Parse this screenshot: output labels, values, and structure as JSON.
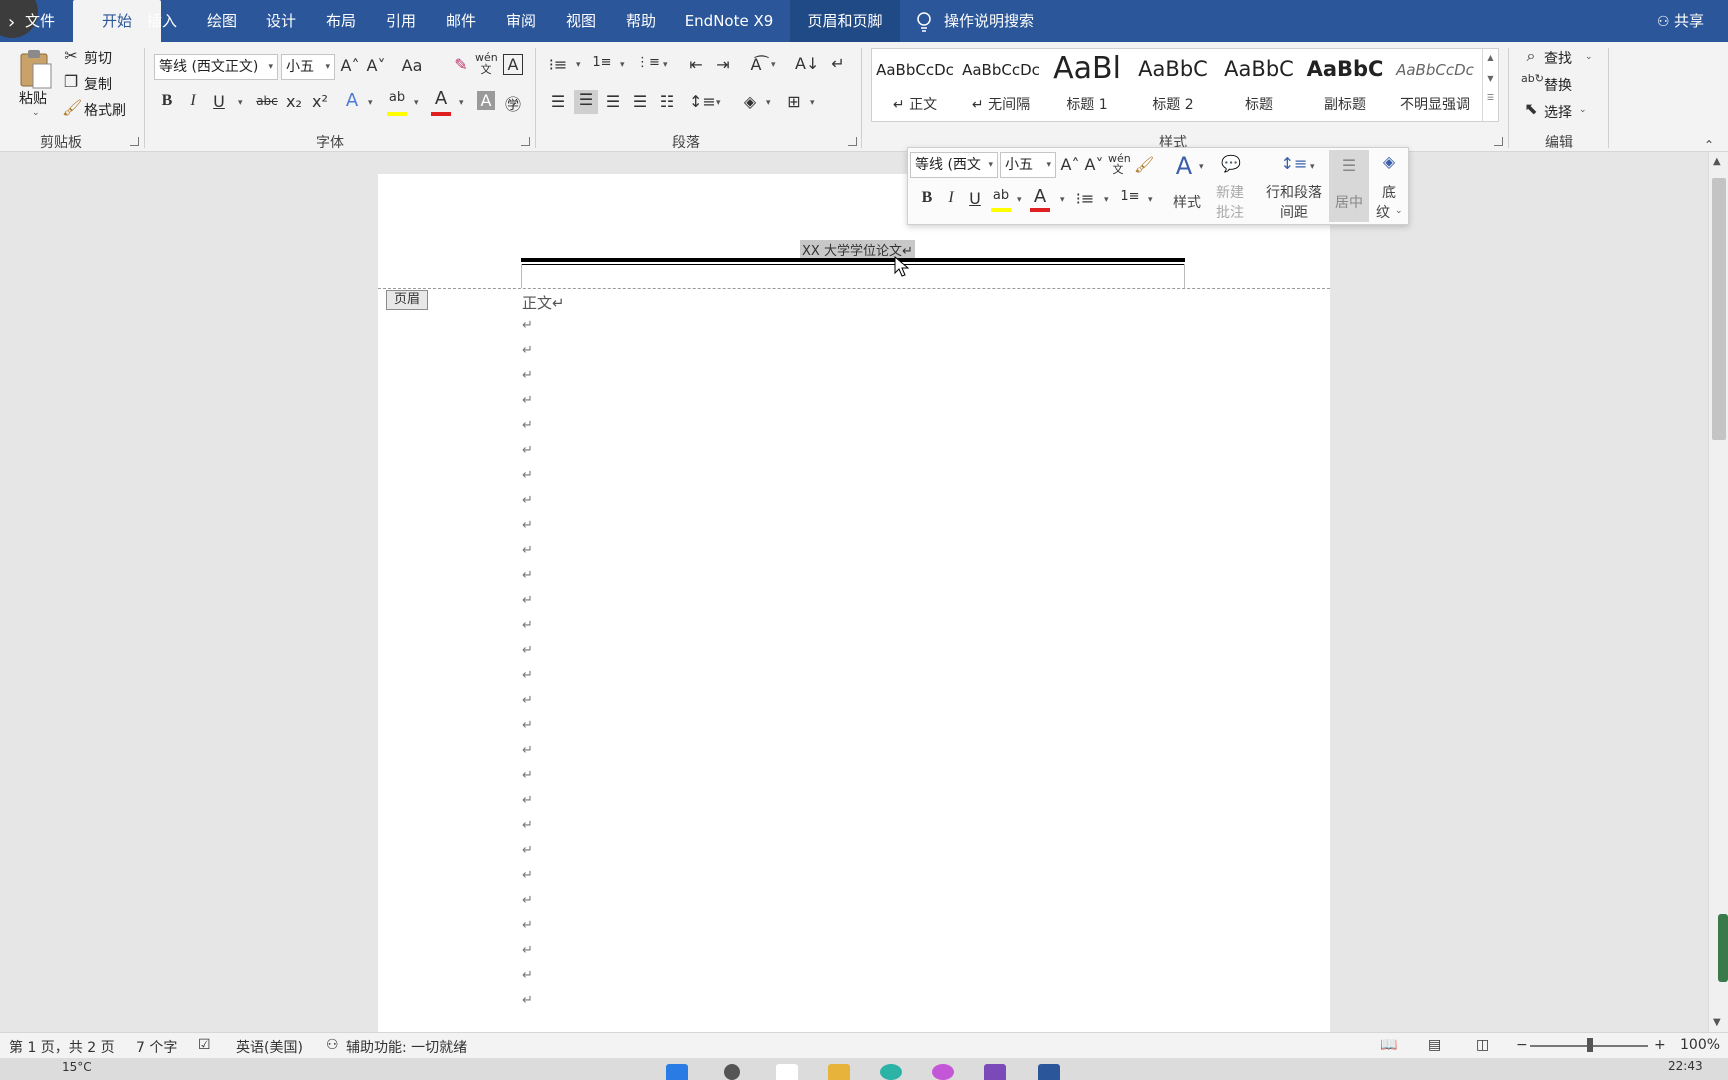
{
  "tabs": {
    "file": "文件",
    "home": "开始",
    "insert": "插入",
    "draw": "绘图",
    "design": "设计",
    "layout": "布局",
    "references": "引用",
    "mailings": "邮件",
    "review": "审阅",
    "view": "视图",
    "help": "帮助",
    "endnote": "EndNote X9",
    "header_footer": "页眉和页脚",
    "tell_me": "操作说明搜索",
    "share": "共享"
  },
  "clipboard": {
    "paste": "粘贴",
    "cut": "剪切",
    "copy": "复制",
    "format_painter": "格式刷",
    "label": "剪贴板"
  },
  "font": {
    "name": "等线 (西文正文)",
    "size": "小五",
    "label": "字体",
    "grow": "A˄",
    "shrink": "A˅",
    "change_case": "Aa",
    "bold": "B",
    "italic": "I",
    "underline": "U",
    "strikethrough": "abc",
    "subscript": "x₂",
    "superscript": "x²",
    "font_color_letter": "A",
    "phonetic": "wén",
    "char_border": "A"
  },
  "paragraph": {
    "label": "段落"
  },
  "styles": {
    "label": "样式",
    "items": [
      {
        "preview": "AaBbCcDc",
        "name": "↵ 正文"
      },
      {
        "preview": "AaBbCcDc",
        "name": "↵ 无间隔"
      },
      {
        "preview": "AaBl",
        "name": "标题 1"
      },
      {
        "preview": "AaBbC",
        "name": "标题 2"
      },
      {
        "preview": "AaBbC",
        "name": "标题"
      },
      {
        "preview": "AaBbC",
        "name": "副标题"
      },
      {
        "preview": "AaBbCcDc",
        "name": "不明显强调"
      }
    ]
  },
  "editing": {
    "find": "查找",
    "replace": "替换",
    "select": "选择",
    "label": "编辑"
  },
  "mini_toolbar": {
    "font": "等线 (西文",
    "size": "小五",
    "styles": "样式",
    "new_comment_1": "新建",
    "new_comment_2": "批注",
    "spacing_1": "行和段落",
    "spacing_2": "间距",
    "center": "居中",
    "shading_1": "底",
    "shading_2": "纹"
  },
  "document": {
    "header_text": "XX 大学学位论文↵",
    "header_tag": "页眉",
    "body_first": "正文↵",
    "para_mark": "↵"
  },
  "status": {
    "page": "第 1 页，共 2 页",
    "words": "7 个字",
    "language": "英语(美国)",
    "accessibility": "辅助功能: 一切就绪",
    "zoom": "100%"
  },
  "taskbar": {
    "temperature": "15°C",
    "time": "22:43"
  },
  "colors": {
    "accent": "#2b579a",
    "highlight": "#ffff00",
    "font_color": "#e02020"
  }
}
